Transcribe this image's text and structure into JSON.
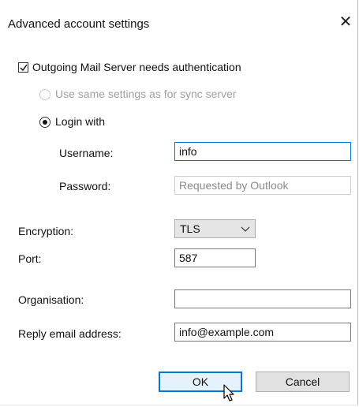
{
  "dialog": {
    "title": "Advanced account settings",
    "close_glyph": "✕"
  },
  "auth": {
    "needs_auth_label": "Outgoing Mail Server needs authentication",
    "needs_auth_checked": true,
    "same_settings_label": "Use same settings as for sync server",
    "login_with_label": "Login with",
    "username_label": "Username:",
    "username_value": "info",
    "password_label": "Password:",
    "password_placeholder": "Requested by Outlook"
  },
  "server": {
    "encryption_label": "Encryption:",
    "encryption_value": "TLS",
    "port_label": "Port:",
    "port_value": "587"
  },
  "account": {
    "organisation_label": "Organisation:",
    "organisation_value": "",
    "reply_label": "Reply email address:",
    "reply_value": "info@example.com"
  },
  "buttons": {
    "ok_label": "OK",
    "cancel_label": "Cancel"
  },
  "colors": {
    "accent": "#0078d7",
    "window_edge": "#f0c040"
  }
}
